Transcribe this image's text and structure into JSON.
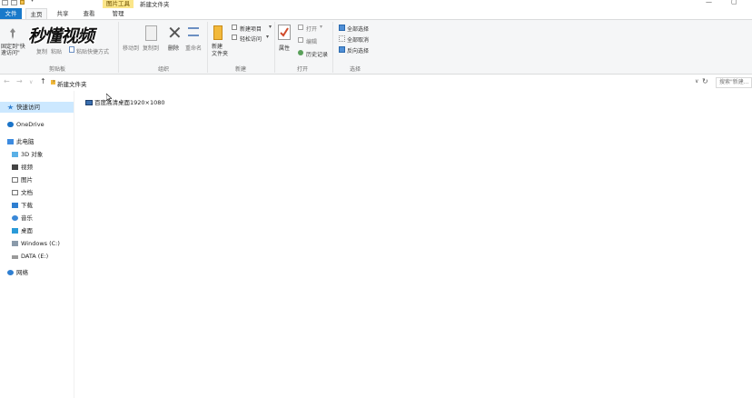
{
  "colors": {
    "file_tab": "#1979ca",
    "picture_tools": "#fbe68a",
    "selected_nav": "#cce8ff",
    "ribbon_bg": "#f5f6f7"
  },
  "titlebar": {
    "picture_tools_label": "图片工具",
    "window_title": "新建文件夹",
    "minimize": "—",
    "maximize": "▢"
  },
  "tabs": {
    "file": "文件",
    "home": "主页",
    "share": "共享",
    "view": "查看",
    "manage": "管理"
  },
  "ribbon": {
    "clipboard": {
      "pin": "固定到\"快速访问\"",
      "copy": "复制",
      "paste": "粘贴",
      "paste_shortcut": "粘贴快捷方式",
      "label": "剪贴板"
    },
    "organize": {
      "move_to": "移动到",
      "copy_to": "复制到",
      "delete": "删除",
      "rename": "重命名",
      "label": "组织"
    },
    "new": {
      "new_folder": "新建\n文件夹",
      "new_item": "新建项目",
      "easy_access": "轻松访问",
      "label": "新建"
    },
    "open": {
      "properties": "属性",
      "open": "打开",
      "edit": "编辑",
      "history": "历史记录",
      "label": "打开"
    },
    "select": {
      "select_all": "全部选择",
      "select_none": "全部取消",
      "invert": "反向选择",
      "label": "选择"
    }
  },
  "watermark": "秒懂视频",
  "address": {
    "path": "新建文件夹",
    "search_placeholder": "搜索\"新建..."
  },
  "nav": {
    "quick_access": "快速访问",
    "onedrive": "OneDrive",
    "this_pc": "此电脑",
    "objects_3d": "3D 对象",
    "videos": "视频",
    "pictures": "图片",
    "documents": "文档",
    "downloads": "下载",
    "music": "音乐",
    "desktop": "桌面",
    "drive_c": "Windows (C:)",
    "drive_e": "DATA (E:)",
    "network": "网络"
  },
  "files": [
    {
      "name": "百度高清桌面1920×1080"
    }
  ]
}
